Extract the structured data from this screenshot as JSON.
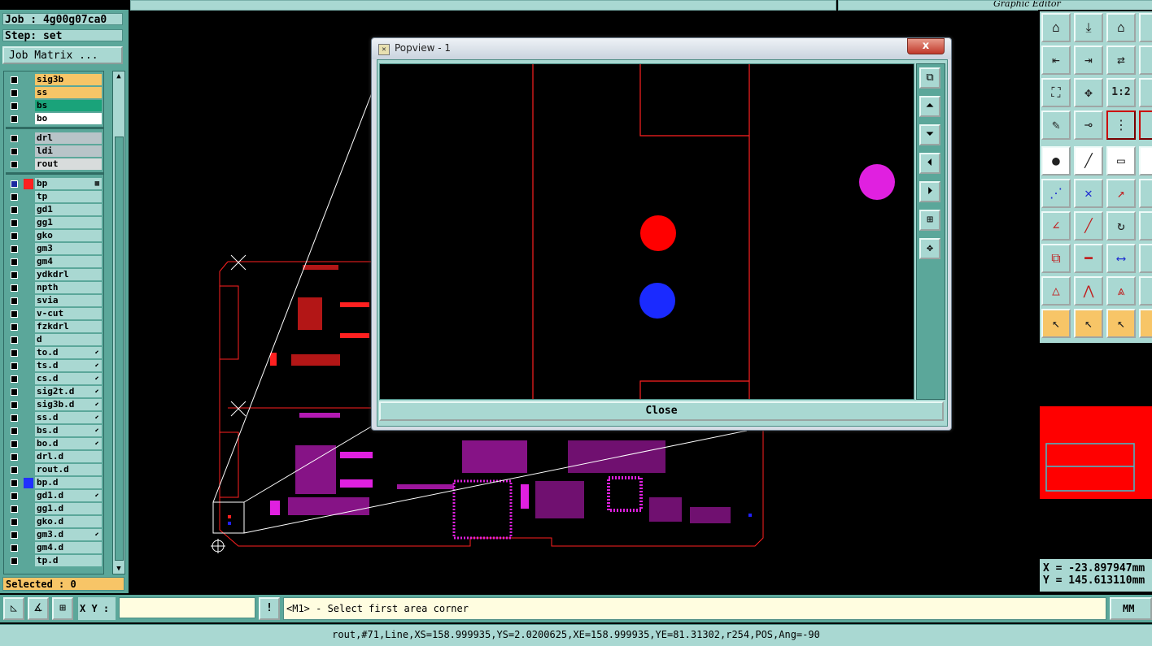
{
  "header": {
    "job_label": "Job : 4g00g07ca0",
    "step_label": "Step: set",
    "job_matrix_button": "Job Matrix ...",
    "app_title_partial": "Graphic Editor"
  },
  "layers": [
    {
      "name": "sig3b",
      "color": "#f7c567",
      "flag": ""
    },
    {
      "name": "ss",
      "color": "#f7c567",
      "flag": ""
    },
    {
      "name": "bs",
      "color": "#1aa37a",
      "flag": ""
    },
    {
      "name": "bo",
      "color": "#ffffff",
      "flag": ""
    },
    {
      "name": "drl",
      "color": "#b8c4c8",
      "flag": ""
    },
    {
      "name": "ldi",
      "color": "#b8c4c8",
      "flag": ""
    },
    {
      "name": "rout",
      "color": "#d8dcdc",
      "flag": ""
    },
    {
      "name": "bp",
      "color": "#a9d8d2",
      "flag": "▦"
    },
    {
      "name": "tp",
      "color": "#a9d8d2",
      "flag": ""
    },
    {
      "name": "gd1",
      "color": "#a9d8d2",
      "flag": ""
    },
    {
      "name": "gg1",
      "color": "#a9d8d2",
      "flag": ""
    },
    {
      "name": "gko",
      "color": "#a9d8d2",
      "flag": ""
    },
    {
      "name": "gm3",
      "color": "#a9d8d2",
      "flag": ""
    },
    {
      "name": "gm4",
      "color": "#a9d8d2",
      "flag": ""
    },
    {
      "name": "ydkdrl",
      "color": "#a9d8d2",
      "flag": ""
    },
    {
      "name": "npth",
      "color": "#a9d8d2",
      "flag": ""
    },
    {
      "name": "svia",
      "color": "#a9d8d2",
      "flag": ""
    },
    {
      "name": "v-cut",
      "color": "#a9d8d2",
      "flag": ""
    },
    {
      "name": "fzkdrl",
      "color": "#a9d8d2",
      "flag": ""
    },
    {
      "name": "d",
      "color": "#a9d8d2",
      "flag": ""
    },
    {
      "name": "to.d",
      "color": "#a9d8d2",
      "flag": "⬋"
    },
    {
      "name": "ts.d",
      "color": "#a9d8d2",
      "flag": "⬋"
    },
    {
      "name": "cs.d",
      "color": "#a9d8d2",
      "flag": "⬋"
    },
    {
      "name": "sig2t.d",
      "color": "#a9d8d2",
      "flag": "⬋"
    },
    {
      "name": "sig3b.d",
      "color": "#a9d8d2",
      "flag": "⬋"
    },
    {
      "name": "ss.d",
      "color": "#a9d8d2",
      "flag": "⬋"
    },
    {
      "name": "bs.d",
      "color": "#a9d8d2",
      "flag": "⬋"
    },
    {
      "name": "bo.d",
      "color": "#a9d8d2",
      "flag": "⬋"
    },
    {
      "name": "drl.d",
      "color": "#a9d8d2",
      "flag": ""
    },
    {
      "name": "rout.d",
      "color": "#a9d8d2",
      "flag": ""
    },
    {
      "name": "bp.d",
      "color": "#a9d8d2",
      "flag": ""
    },
    {
      "name": "gd1.d",
      "color": "#a9d8d2",
      "flag": "⬋"
    },
    {
      "name": "gg1.d",
      "color": "#a9d8d2",
      "flag": ""
    },
    {
      "name": "gko.d",
      "color": "#a9d8d2",
      "flag": ""
    },
    {
      "name": "gm3.d",
      "color": "#a9d8d2",
      "flag": "⬋"
    },
    {
      "name": "gm4.d",
      "color": "#a9d8d2",
      "flag": ""
    },
    {
      "name": "tp.d",
      "color": "#a9d8d2",
      "flag": ""
    }
  ],
  "selected_label": "Selected : 0",
  "popview": {
    "title": "Popview - 1",
    "close_x": "x",
    "close_button": "Close"
  },
  "command": {
    "xy_label": "X Y :",
    "xy_value": "",
    "prompt": "<M1> - Select first area corner",
    "units": "MM",
    "alert_icon": "!"
  },
  "coords": {
    "x": "X = -23.897947mm",
    "y": "Y = 145.613110mm"
  },
  "status": "rout,#71,Line,XS=158.999935,YS=2.0200625,XE=158.999935,YE=81.31302,r254,POS,Ang=-90",
  "colors": {
    "panel_teal": "#5ba79a",
    "panel_light": "#a9d8d2",
    "outline_red": "#ff2020",
    "pad_magenta": "#e020e0",
    "pad_blue": "#2020ff"
  }
}
